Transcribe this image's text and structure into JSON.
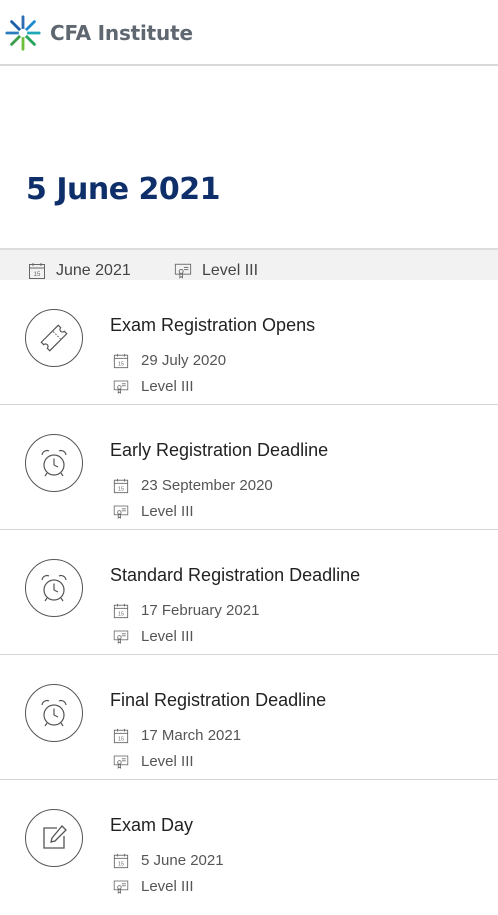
{
  "brand": {
    "name": "CFA Institute"
  },
  "page": {
    "title": "5 June 2021",
    "meta": [
      {
        "icon": "calendar-icon",
        "text": "June 2021"
      },
      {
        "icon": "certificate-icon",
        "text": "Level III"
      }
    ]
  },
  "events": [
    {
      "icon": "ticket-icon",
      "title": "Exam Registration Opens",
      "date": "29 July 2020",
      "level": "Level III"
    },
    {
      "icon": "alarm-clock-icon",
      "title": "Early Registration Deadline",
      "date": "23 September 2020",
      "level": "Level III"
    },
    {
      "icon": "alarm-clock-icon",
      "title": "Standard Registration Deadline",
      "date": "17 February 2021",
      "level": "Level III"
    },
    {
      "icon": "alarm-clock-icon",
      "title": "Final Registration Deadline",
      "date": "17 March 2021",
      "level": "Level III"
    },
    {
      "icon": "edit-icon",
      "title": "Exam Day",
      "date": "5 June 2021",
      "level": "Level III"
    }
  ],
  "colors": {
    "title": "#0f2f6b",
    "logo_text": "#5f6870",
    "divider": "#d4d4d4",
    "gap_background": "#f2f2f2"
  }
}
